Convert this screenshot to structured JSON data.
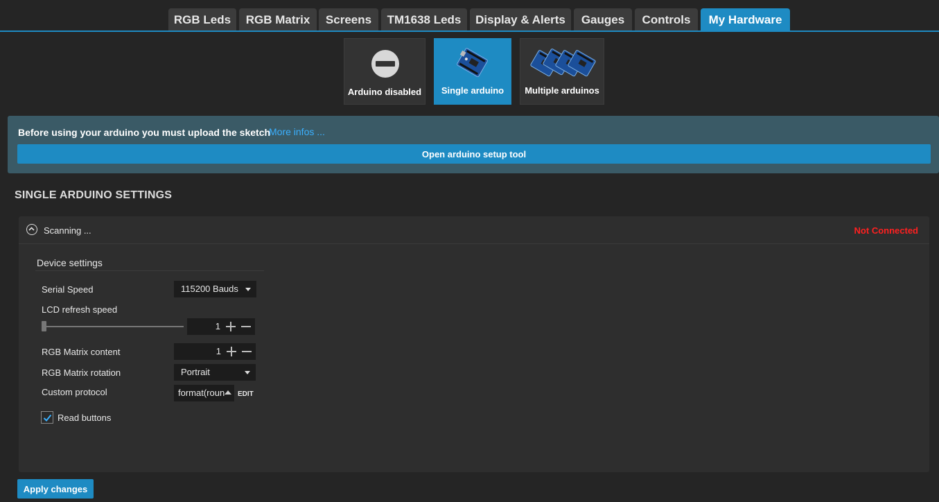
{
  "tabs": [
    {
      "label": "RGB Leds"
    },
    {
      "label": "RGB Matrix"
    },
    {
      "label": "Screens"
    },
    {
      "label": "TM1638 Leds"
    },
    {
      "label": "Display & Alerts"
    },
    {
      "label": "Gauges"
    },
    {
      "label": "Controls"
    },
    {
      "label": "My Hardware",
      "active": true
    }
  ],
  "modes": [
    {
      "label": "Arduino disabled",
      "icon": "disabled-icon"
    },
    {
      "label": "Single arduino",
      "icon": "arduino-board-icon",
      "active": true
    },
    {
      "label": "Multiple arduinos",
      "icon": "multiple-arduino-boards-icon"
    }
  ],
  "banner": {
    "message": "Before using your arduino you must upload the sketch",
    "more_link": "More infos ...",
    "setup_button": "Open arduino setup tool"
  },
  "section_title": "SINGLE ARDUINO SETTINGS",
  "device": {
    "scanning": "Scanning ...",
    "status": "Not Connected",
    "settings_title": "Device settings",
    "serial_speed": {
      "label": "Serial Speed",
      "value": "115200 Bauds"
    },
    "lcd_refresh": {
      "label": "LCD refresh speed",
      "value": "1",
      "slider_level": 0
    },
    "matrix_content": {
      "label": "RGB Matrix content",
      "value": "1"
    },
    "matrix_rotation": {
      "label": "RGB Matrix rotation",
      "value": "Portrait"
    },
    "custom_protocol": {
      "label": "Custom protocol",
      "value": "format(roun",
      "edit_label": "EDIT"
    },
    "read_buttons": {
      "label": "Read buttons",
      "checked": true
    }
  },
  "apply_button": "Apply changes",
  "colors": {
    "accent": "#1e8bc3",
    "status_error": "#ff2020",
    "banner_bg": "#3a5a66"
  }
}
